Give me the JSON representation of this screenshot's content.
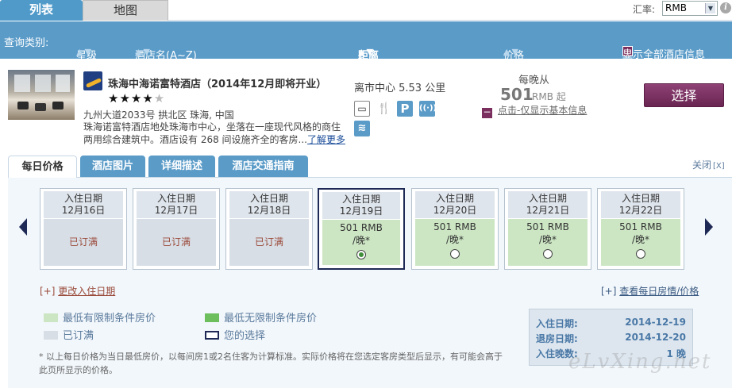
{
  "tabs": {
    "list": "列表",
    "map": "地图"
  },
  "exchange": {
    "label": "汇率:",
    "value": "RMB"
  },
  "sortbar": {
    "query_type": "查询类别:",
    "star": "星级",
    "name": "酒店名(A~Z)",
    "distance": "距离",
    "price": "价格",
    "show_all": "显示全部酒店信息"
  },
  "hotel": {
    "name": "珠海中海诺富特酒店（2014年12月即将开业）",
    "stars": {
      "rating": 4,
      "max": 5
    },
    "address": "九州大道2033号 拱北区 珠海, 中国",
    "description": "珠海诺富特酒店地处珠海市中心，坐落在一座现代风格的商住两用综合建筑中。酒店设有 268 间设施齐全的客房...",
    "more_link": "了解更多",
    "distance": "离市中心 5.53 公里",
    "amenities": [
      {
        "icon": "computer-icon",
        "glyph": "💻"
      },
      {
        "icon": "restaurant-icon",
        "glyph": "🍴"
      },
      {
        "icon": "parking-icon",
        "glyph": "P"
      },
      {
        "icon": "wifi-icon",
        "glyph": "((·))"
      },
      {
        "icon": "pool-icon",
        "glyph": "≋"
      }
    ],
    "price_from": "每晚从",
    "price": "501",
    "price_unit": "RMB 起",
    "basic_info": "点击-仅显示基本信息",
    "select": "选择"
  },
  "detail_tabs": [
    "每日价格",
    "酒店图片",
    "详细描述",
    "酒店交通指南"
  ],
  "close": "关闭",
  "days": [
    {
      "label": "入住日期",
      "date": "12月16日",
      "status": "已订满"
    },
    {
      "label": "入住日期",
      "date": "12月17日",
      "status": "已订满"
    },
    {
      "label": "入住日期",
      "date": "12月18日",
      "status": "已订满"
    },
    {
      "label": "入住日期",
      "date": "12月19日",
      "price": "501 RMB",
      "per": "/晚*"
    },
    {
      "label": "入住日期",
      "date": "12月20日",
      "price": "501 RMB",
      "per": "/晚*"
    },
    {
      "label": "入住日期",
      "date": "12月21日",
      "price": "501 RMB",
      "per": "/晚*"
    },
    {
      "label": "入住日期",
      "date": "12月22日",
      "price": "501 RMB",
      "per": "/晚*"
    }
  ],
  "change_date": {
    "prefix": "[+]",
    "text": "更改入住日期"
  },
  "view_daily": {
    "prefix": "[+]",
    "text": "查看每日房情/价格"
  },
  "legend": {
    "restricted": "最低有限制条件房价",
    "unrestricted": "最低无限制条件房价",
    "full": "已订满",
    "selection": "您的选择"
  },
  "colors": {
    "restricted": "#cce6c4",
    "unrestricted": "#6cbf5c",
    "full": "#d8dee6",
    "selection": "#1e2a55"
  },
  "note": "* 以上每日价格为当日最低房价，以每间房1或2名住客为计算标准。实际价格将在您选定客房类型后显示，有可能会高于此页所显示的价格。",
  "summary": {
    "checkin_label": "入住日期:",
    "checkin": "2014-12-19",
    "checkout_label": "退房日期:",
    "checkout": "2014-12-20",
    "nights_label": "入住晚数:",
    "nights": "1 晚"
  },
  "watermark": "eLvXing.net"
}
